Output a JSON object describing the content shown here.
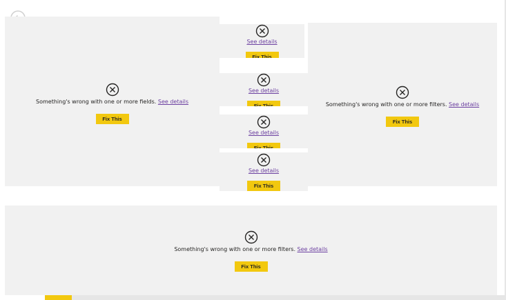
{
  "errors": {
    "fields_message": "Something's wrong with one or more fields.",
    "filters_message": "Something's wrong with one or more filters.",
    "see_details": "See details",
    "fix_this": "Fix This"
  },
  "icons": {
    "back": "back-arrow-icon",
    "error": "error-circle-x-icon"
  },
  "colors": {
    "panel_bg": "#f1f1f1",
    "button_bg": "#f2c80f",
    "link": "#6b3fa0"
  }
}
